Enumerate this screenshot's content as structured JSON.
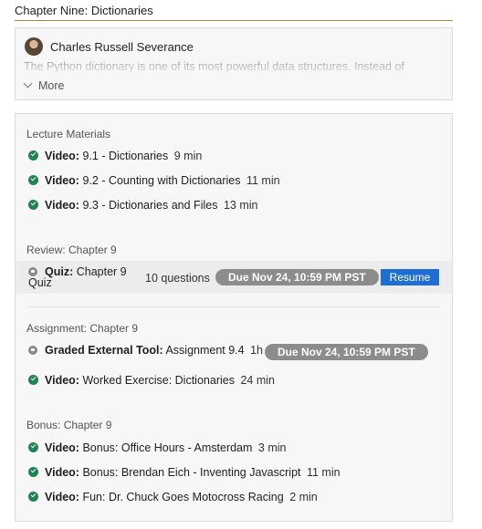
{
  "chapter": {
    "title": "Chapter Nine: Dictionaries"
  },
  "intro": {
    "author": "Charles Russell Severance",
    "description": "The Python dictionary is one of its most powerful data structures. Instead of",
    "more_label": "More"
  },
  "sections": {
    "lecture": {
      "label": "Lecture Materials",
      "items": [
        {
          "type": "Video:",
          "title": "9.1 - Dictionaries",
          "duration": "9 min"
        },
        {
          "type": "Video:",
          "title": "9.2 - Counting with Dictionaries",
          "duration": "11 min"
        },
        {
          "type": "Video:",
          "title": "9.3 - Dictionaries and Files",
          "duration": "13 min"
        }
      ]
    },
    "review": {
      "label": "Review: Chapter 9",
      "quiz": {
        "type": "Quiz:",
        "title": "Chapter 9 Quiz",
        "questions": "10 questions",
        "due": "Due Nov 24, 10:59 PM PST",
        "action": "Resume"
      }
    },
    "assignment": {
      "label": "Assignment: Chapter 9",
      "tool": {
        "type": "Graded External Tool:",
        "title": "Assignment 9.4",
        "duration": "1h",
        "due": "Due Nov 24, 10:59 PM PST"
      },
      "video": {
        "type": "Video:",
        "title": "Worked Exercise: Dictionaries",
        "duration": "24 min"
      }
    },
    "bonus": {
      "label": "Bonus: Chapter 9",
      "items": [
        {
          "type": "Video:",
          "title": "Bonus: Office Hours - Amsterdam",
          "duration": "3 min"
        },
        {
          "type": "Video:",
          "title": "Bonus: Brendan Eich - Inventing Javascript",
          "duration": "11 min"
        },
        {
          "type": "Video:",
          "title": "Fun: Dr. Chuck Goes Motocross Racing",
          "duration": "2 min"
        }
      ]
    }
  },
  "icons": {
    "completed": "check-circle-icon",
    "locked": "lock-icon",
    "expand": "chevron-down-icon"
  },
  "colors": {
    "complete_green": "#1f8354",
    "resume_blue": "#1f6ed4",
    "due_pill_gray": "#8c8c8c",
    "header_rule": "#a08a3c"
  }
}
